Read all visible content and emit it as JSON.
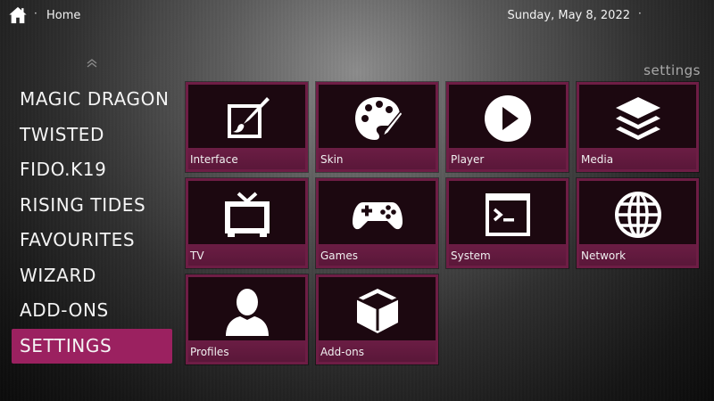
{
  "header": {
    "home_icon": "home-icon",
    "separator": "·",
    "breadcrumb": "Home",
    "date": "Sunday, May 8, 2022",
    "date_separator": "·"
  },
  "section_label": "settings",
  "menu": {
    "items": [
      {
        "label": "MAGIC DRAGON"
      },
      {
        "label": "TWISTED"
      },
      {
        "label": "FIDO.K19"
      },
      {
        "label": "RISING TIDES"
      },
      {
        "label": "FAVOURITES"
      },
      {
        "label": "WIZARD"
      },
      {
        "label": "ADD-ONS"
      },
      {
        "label": "SETTINGS",
        "active": true
      }
    ]
  },
  "tiles": [
    {
      "label": "Interface",
      "icon": "paint-canvas-icon"
    },
    {
      "label": "Skin",
      "icon": "palette-icon"
    },
    {
      "label": "Player",
      "icon": "play-icon"
    },
    {
      "label": "Media",
      "icon": "layers-icon"
    },
    {
      "label": "TV",
      "icon": "tv-icon"
    },
    {
      "label": "Games",
      "icon": "gamepad-icon"
    },
    {
      "label": "System",
      "icon": "terminal-icon"
    },
    {
      "label": "Network",
      "icon": "globe-icon"
    },
    {
      "label": "Profiles",
      "icon": "user-icon"
    },
    {
      "label": "Add-ons",
      "icon": "box-icon"
    }
  ],
  "colors": {
    "accent": "#9b2160",
    "tile_border": "#6e1d45",
    "tile_bg": "#1c0810"
  }
}
